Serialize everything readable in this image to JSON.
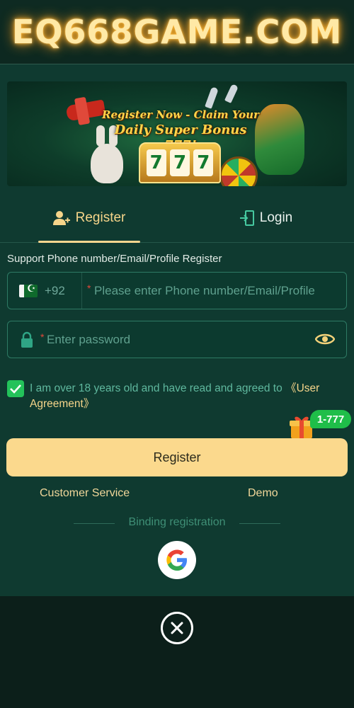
{
  "header": {
    "site_title": "EQ668GAME.COM"
  },
  "banner": {
    "headline_line1": "Register Now - Claim Your",
    "headline_line2": "Daily Super Bonus 777!",
    "reels": [
      "7",
      "7",
      "7"
    ]
  },
  "tabs": [
    {
      "label": "Register",
      "icon": "add-user-icon",
      "active": true
    },
    {
      "label": "Login",
      "icon": "login-door-icon",
      "active": false
    }
  ],
  "form": {
    "support_label": "Support Phone number/Email/Profile Register",
    "country_code": "+92",
    "country_flag": "pakistan-flag-icon",
    "account_placeholder": "Please enter Phone number/Email/Profile",
    "password_placeholder": "Enter password",
    "required_mark": "*",
    "agree_text": "I am over 18 years old and have read and agreed to",
    "agreement_link": "《User Agreement》",
    "agree_checked": true
  },
  "bonus_badge": "1-777",
  "register_button": "Register",
  "links": {
    "customer_service": "Customer Service",
    "demo": "Demo"
  },
  "binding": {
    "label": "Binding registration",
    "provider_icon": "google-icon"
  },
  "colors": {
    "accent_gold": "#fbd98d",
    "panel_green": "#0f3a30",
    "check_green": "#23c25a",
    "title_glow": "#ffb52e"
  }
}
